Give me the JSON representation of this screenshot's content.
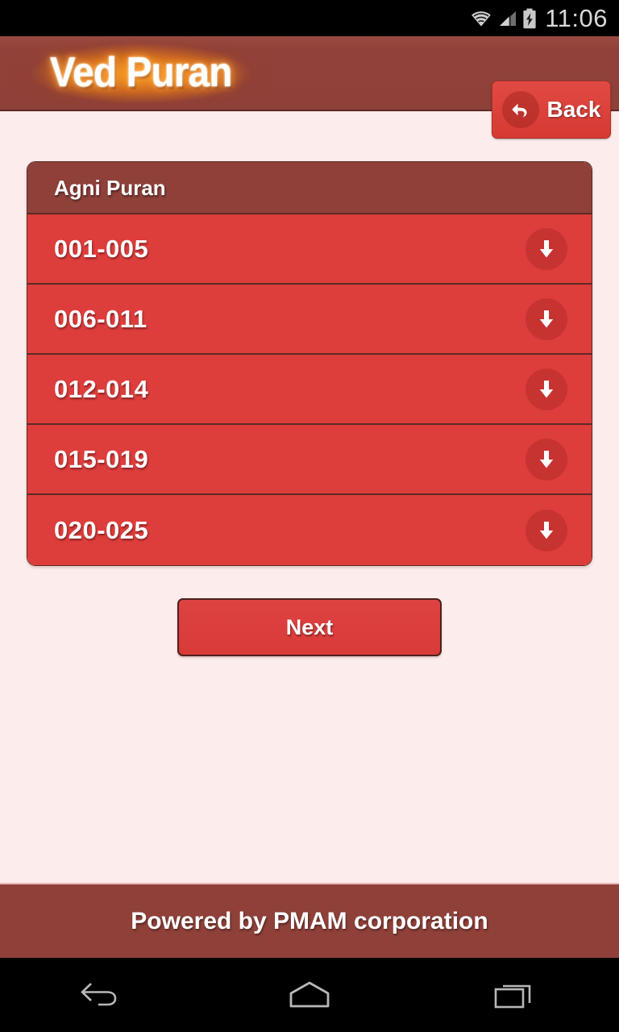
{
  "status_bar": {
    "time": "11:06",
    "icons": [
      "wifi-icon",
      "signal-icon",
      "battery-charging-icon"
    ]
  },
  "app_header": {
    "logo_text": "Ved Puran",
    "back_button": {
      "label": "Back",
      "icon": "back-arrow-icon"
    }
  },
  "list_card": {
    "header_title": "Agni Puran",
    "rows": [
      {
        "label": "001-005",
        "icon": "download-icon"
      },
      {
        "label": "006-011",
        "icon": "download-icon"
      },
      {
        "label": "012-014",
        "icon": "download-icon"
      },
      {
        "label": "015-019",
        "icon": "download-icon"
      },
      {
        "label": "020-025",
        "icon": "download-icon"
      }
    ]
  },
  "next_button": {
    "label": "Next"
  },
  "footer": {
    "text": "Powered by PMAM corporation"
  },
  "nav_bar": {
    "buttons": [
      "back-nav-icon",
      "home-nav-icon",
      "recents-nav-icon"
    ]
  },
  "colors": {
    "page_background": "#fdecec",
    "header_bar": "#8e4039",
    "row_red": "#dd3d3b",
    "accent_red": "#d83a38",
    "border_dark": "#5d2a25",
    "logo_glow": "#ff8a1e",
    "status_bar": "#000000"
  }
}
